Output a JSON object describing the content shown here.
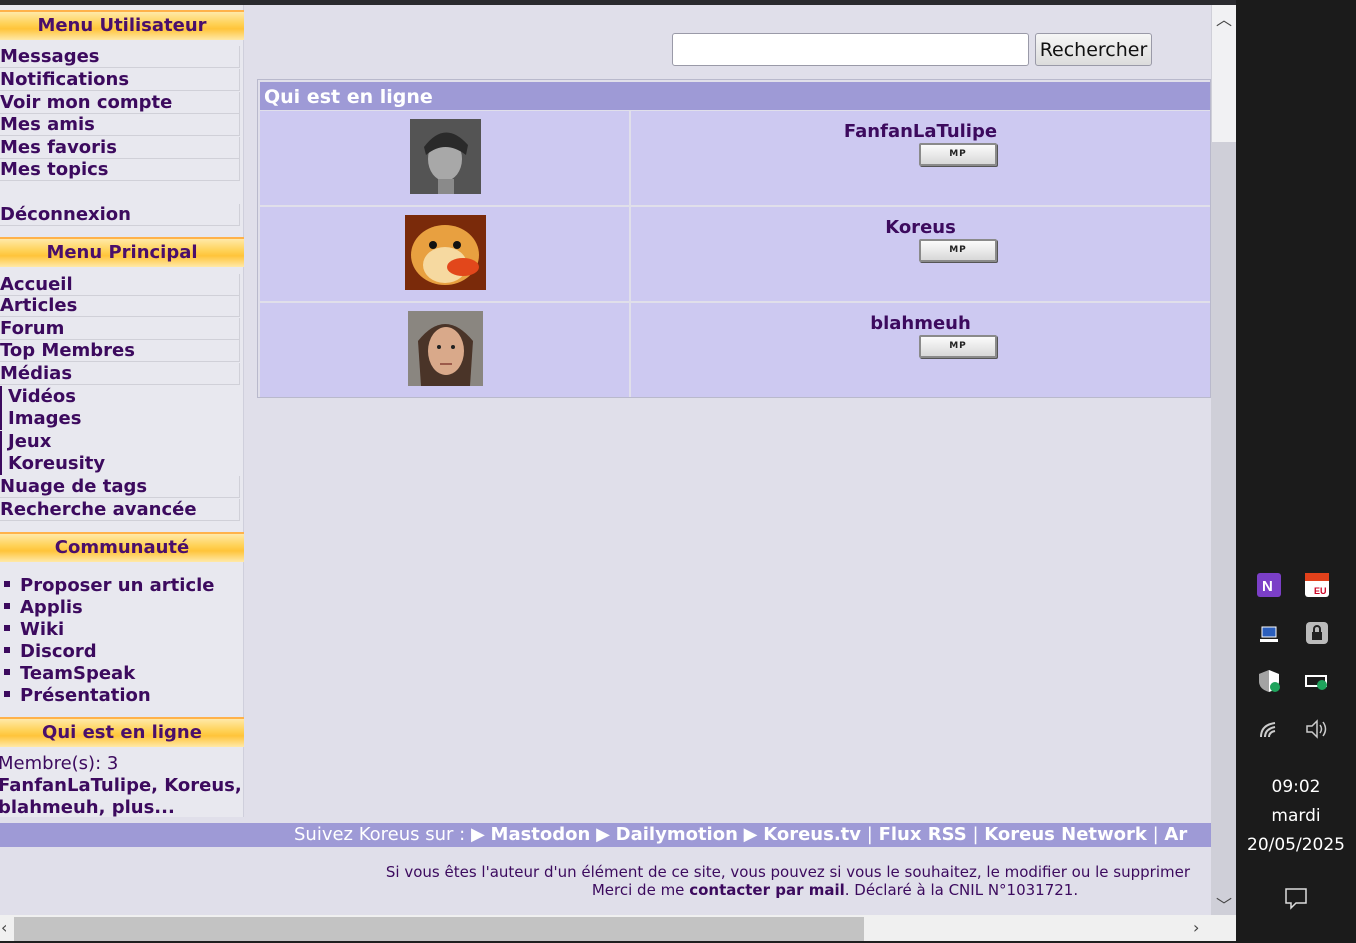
{
  "user_menu": {
    "title": "Menu Utilisateur",
    "items": [
      "Messages",
      "Notifications",
      "Voir mon compte",
      "Mes amis",
      "Mes favoris",
      "Mes topics"
    ],
    "logout": "Déconnexion"
  },
  "main_menu": {
    "title": "Menu Principal",
    "items": [
      "Accueil",
      "Articles",
      "Forum",
      "Top Membres",
      "Médias"
    ],
    "media_sub": [
      "Vidéos",
      "Images",
      "Jeux",
      "Koreusity"
    ],
    "items2": [
      "Nuage de tags",
      "Recherche avancée"
    ]
  },
  "community": {
    "title": "Communauté",
    "items": [
      "Proposer un article",
      "Applis",
      "Wiki",
      "Discord",
      "TeamSpeak",
      "Présentation"
    ]
  },
  "online_side": {
    "title": "Qui est en ligne",
    "members_line": "Membre(s): 3",
    "names_line1": "FanfanLaTulipe, Koreus,",
    "names_line2": "blahmeuh, plus..."
  },
  "search": {
    "button": "Rechercher",
    "value": ""
  },
  "online_table": {
    "title": "Qui est en ligne",
    "users": [
      {
        "name": "FanfanLaTulipe",
        "mp": "MP"
      },
      {
        "name": "Koreus",
        "mp": "MP"
      },
      {
        "name": "blahmeuh",
        "mp": "MP"
      }
    ]
  },
  "footer": {
    "follow_prefix": "Suivez Koreus sur :",
    "links": [
      "Mastodon",
      "Dailymotion",
      "Koreus.tv",
      "Flux RSS",
      "Koreus Network",
      "Ar"
    ],
    "line1": "Si vous êtes l'auteur d'un élément de ce site, vous pouvez si vous le souhaitez, le modifier ou le supprimer",
    "line2_a": "Merci de me ",
    "line2_link": "contacter par mail",
    "line2_b": ". Déclaré à la CNIL N°1031721."
  },
  "taskbar": {
    "time": "09:02",
    "day": "mardi",
    "date": "20/05/2025",
    "icons": [
      "onenote-icon",
      "calendar-eu-icon",
      "network-drive-icon",
      "lock-icon",
      "defender-shield-icon",
      "battery-icon",
      "wifi-icon",
      "volume-icon",
      "notification-icon"
    ]
  }
}
